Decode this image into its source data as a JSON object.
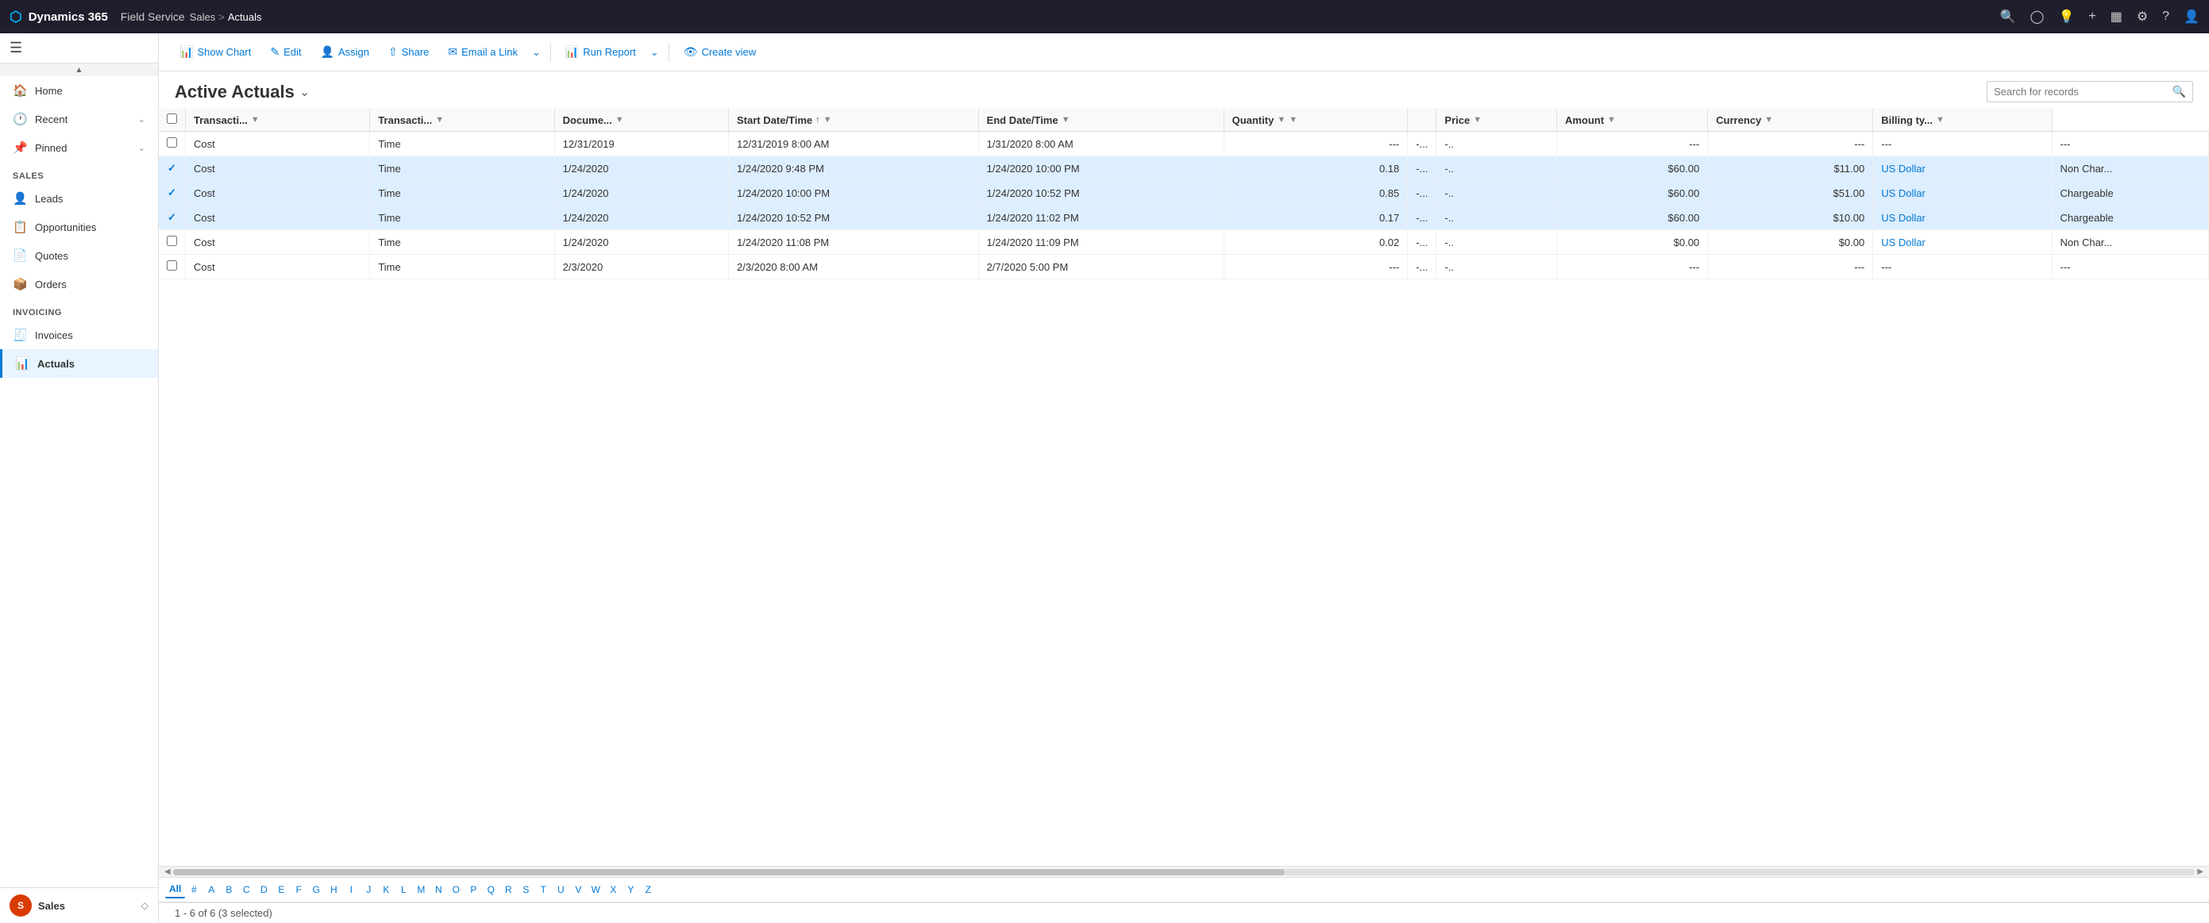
{
  "topNav": {
    "brand": "Dynamics 365",
    "module": "Field Service",
    "breadcrumb": {
      "parent": "Sales",
      "separator": ">",
      "current": "Actuals"
    },
    "icons": [
      "search",
      "circle-check",
      "lightbulb",
      "plus",
      "filter",
      "settings",
      "help",
      "user"
    ]
  },
  "sidebar": {
    "topIcons": [
      "hamburger"
    ],
    "navItems": [
      {
        "id": "home",
        "label": "Home",
        "icon": "🏠",
        "expandable": false
      },
      {
        "id": "recent",
        "label": "Recent",
        "icon": "🕐",
        "expandable": true
      },
      {
        "id": "pinned",
        "label": "Pinned",
        "icon": "📌",
        "expandable": true
      }
    ],
    "salesSection": "Sales",
    "salesItems": [
      {
        "id": "leads",
        "label": "Leads",
        "icon": "👤"
      },
      {
        "id": "opportunities",
        "label": "Opportunities",
        "icon": "📋"
      },
      {
        "id": "quotes",
        "label": "Quotes",
        "icon": "📄"
      },
      {
        "id": "orders",
        "label": "Orders",
        "icon": "📦"
      }
    ],
    "invoicingSection": "Invoicing",
    "invoicingItems": [
      {
        "id": "invoices",
        "label": "Invoices",
        "icon": "🧾"
      },
      {
        "id": "actuals",
        "label": "Actuals",
        "icon": "📊",
        "active": true
      }
    ],
    "bottomArea": {
      "avatarInitial": "S",
      "label": "Sales"
    }
  },
  "toolbar": {
    "showChart": "Show Chart",
    "edit": "Edit",
    "assign": "Assign",
    "share": "Share",
    "emailALink": "Email a Link",
    "runReport": "Run Report",
    "createView": "Create view"
  },
  "pageHeader": {
    "title": "Active Actuals",
    "searchPlaceholder": "Search for records"
  },
  "table": {
    "columns": [
      {
        "key": "check",
        "label": ""
      },
      {
        "key": "transactionType",
        "label": "Transacti...",
        "filterable": true
      },
      {
        "key": "transactionCategory",
        "label": "Transacti...",
        "filterable": true
      },
      {
        "key": "document",
        "label": "Docume...",
        "filterable": true
      },
      {
        "key": "startDateTime",
        "label": "Start Date/Time",
        "sortable": true,
        "filterable": true
      },
      {
        "key": "endDateTime",
        "label": "End Date/Time",
        "filterable": true
      },
      {
        "key": "quantity",
        "label": "Quantity",
        "filterable": true
      },
      {
        "key": "col8",
        "label": ""
      },
      {
        "key": "price",
        "label": "Price",
        "filterable": true
      },
      {
        "key": "amount",
        "label": "Amount",
        "filterable": true
      },
      {
        "key": "currency",
        "label": "Currency",
        "filterable": true
      },
      {
        "key": "billingType",
        "label": "Billing ty...",
        "filterable": true
      }
    ],
    "rows": [
      {
        "selected": false,
        "check": "",
        "transactionType": "Cost",
        "transactionCategory": "Time",
        "document": "12/31/2019",
        "startDateTime": "12/31/2019 8:00 AM",
        "endDateTime": "1/31/2020 8:00 AM",
        "quantity": "---",
        "col8": "-...",
        "col8b": "-..",
        "price": "---",
        "amount": "---",
        "currency": "---",
        "billingType": "---"
      },
      {
        "selected": true,
        "check": "✓",
        "transactionType": "Cost",
        "transactionCategory": "Time",
        "document": "1/24/2020",
        "startDateTime": "1/24/2020 9:48 PM",
        "endDateTime": "1/24/2020 10:00 PM",
        "quantity": "0.18",
        "col8": "-...",
        "col8b": "-..",
        "price": "$60.00",
        "amount": "$11.00",
        "currency": "US Dollar",
        "billingType": "Non Char..."
      },
      {
        "selected": true,
        "check": "✓",
        "transactionType": "Cost",
        "transactionCategory": "Time",
        "document": "1/24/2020",
        "startDateTime": "1/24/2020 10:00 PM",
        "endDateTime": "1/24/2020 10:52 PM",
        "quantity": "0.85",
        "col8": "-...",
        "col8b": "-..",
        "price": "$60.00",
        "amount": "$51.00",
        "currency": "US Dollar",
        "billingType": "Chargeable"
      },
      {
        "selected": true,
        "check": "✓",
        "transactionType": "Cost",
        "transactionCategory": "Time",
        "document": "1/24/2020",
        "startDateTime": "1/24/2020 10:52 PM",
        "endDateTime": "1/24/2020 11:02 PM",
        "quantity": "0.17",
        "col8": "-...",
        "col8b": "-..",
        "price": "$60.00",
        "amount": "$10.00",
        "currency": "US Dollar",
        "billingType": "Chargeable"
      },
      {
        "selected": false,
        "check": "",
        "transactionType": "Cost",
        "transactionCategory": "Time",
        "document": "1/24/2020",
        "startDateTime": "1/24/2020 11:08 PM",
        "endDateTime": "1/24/2020 11:09 PM",
        "quantity": "0.02",
        "col8": "-...",
        "col8b": "-..",
        "price": "$0.00",
        "amount": "$0.00",
        "currency": "US Dollar",
        "billingType": "Non Char..."
      },
      {
        "selected": false,
        "check": "",
        "transactionType": "Cost",
        "transactionCategory": "Time",
        "document": "2/3/2020",
        "startDateTime": "2/3/2020 8:00 AM",
        "endDateTime": "2/7/2020 5:00 PM",
        "quantity": "---",
        "col8": "-...",
        "col8b": "-..",
        "price": "---",
        "amount": "---",
        "currency": "---",
        "billingType": "---"
      }
    ]
  },
  "alphaNav": {
    "active": "All",
    "items": [
      "All",
      "#",
      "A",
      "B",
      "C",
      "D",
      "E",
      "F",
      "G",
      "H",
      "I",
      "J",
      "K",
      "L",
      "M",
      "N",
      "O",
      "P",
      "Q",
      "R",
      "S",
      "T",
      "U",
      "V",
      "W",
      "X",
      "Y",
      "Z"
    ]
  },
  "statusBar": {
    "text": "1 - 6 of 6 (3 selected)"
  }
}
